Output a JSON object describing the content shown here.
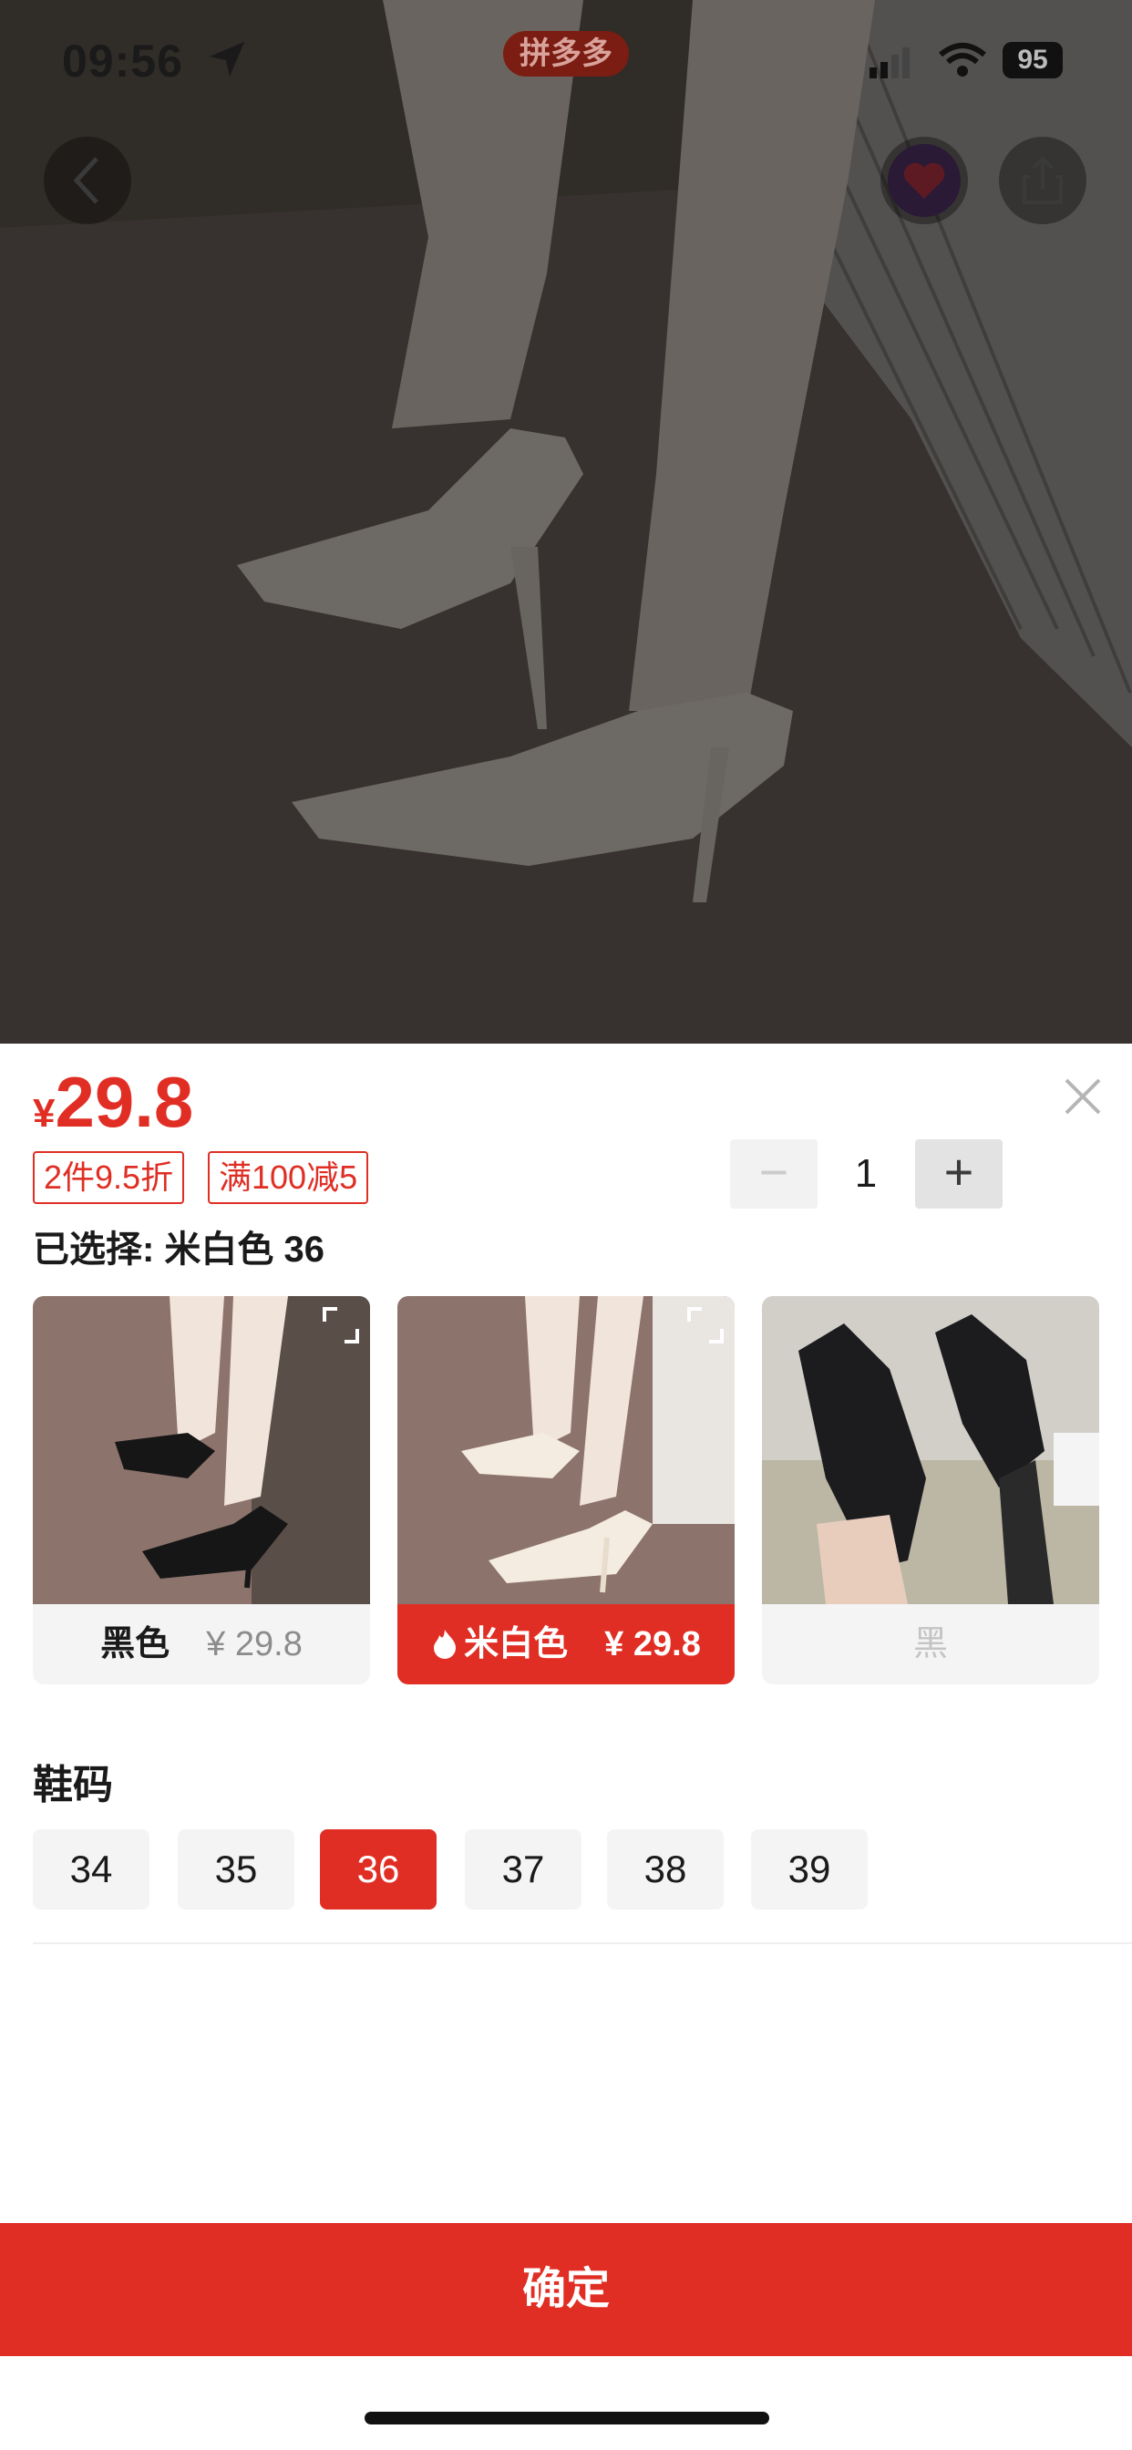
{
  "status_bar": {
    "time": "09:56",
    "app_badge": "拼多多",
    "battery": "95"
  },
  "product": {
    "currency": "¥",
    "price": "29.8",
    "promos": [
      "2件9.5折",
      "满100减5"
    ],
    "quantity": "1",
    "selected_text": "已选择: 米白色 36"
  },
  "colors": [
    {
      "name": "黑色",
      "price": "¥ 29.8",
      "state": "normal"
    },
    {
      "name": "米白色",
      "price": "¥ 29.8",
      "state": "selected"
    },
    {
      "name": "黑",
      "price": "",
      "state": "disabled"
    }
  ],
  "size_section": {
    "title": "鞋码",
    "sizes": [
      "34",
      "35",
      "36",
      "37",
      "38",
      "39"
    ],
    "selected": "36"
  },
  "confirm_label": "确定",
  "theme": {
    "accent": "#e02e24"
  }
}
